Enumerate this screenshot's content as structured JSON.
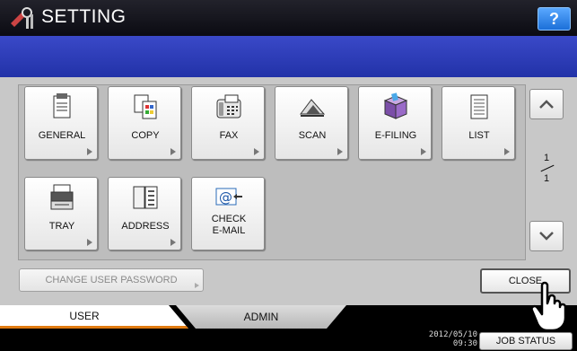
{
  "header": {
    "title": "SETTING",
    "icon": "setting-tools-icon",
    "help_label": "?"
  },
  "menu": {
    "tiles": [
      {
        "label": "GENERAL",
        "icon": "general-document-icon"
      },
      {
        "label": "COPY",
        "icon": "copy-icon"
      },
      {
        "label": "FAX",
        "icon": "fax-machine-icon"
      },
      {
        "label": "SCAN",
        "icon": "scanner-icon"
      },
      {
        "label": "E-FILING",
        "icon": "e-filing-box-icon"
      },
      {
        "label": "LIST",
        "icon": "list-document-icon"
      },
      {
        "label": "TRAY",
        "icon": "tray-printer-icon"
      },
      {
        "label": "ADDRESS",
        "icon": "address-book-icon"
      },
      {
        "label": "CHECK\nE-MAIL",
        "label_line1": "CHECK",
        "label_line2": "E-MAIL",
        "icon": "check-email-icon"
      }
    ]
  },
  "pager": {
    "current": "1",
    "total": "1"
  },
  "actions": {
    "change_password_label": "CHANGE USER PASSWORD",
    "close_label": "CLOSE"
  },
  "tabs": {
    "user_label": "USER",
    "admin_label": "ADMIN"
  },
  "status": {
    "date": "2012/05/10",
    "time": "09:30",
    "job_status_label": "JOB STATUS"
  },
  "colors": {
    "accent_tab_underline": "#e07a10",
    "help_button": "#2a80e8",
    "band": "#2d3cb8"
  }
}
